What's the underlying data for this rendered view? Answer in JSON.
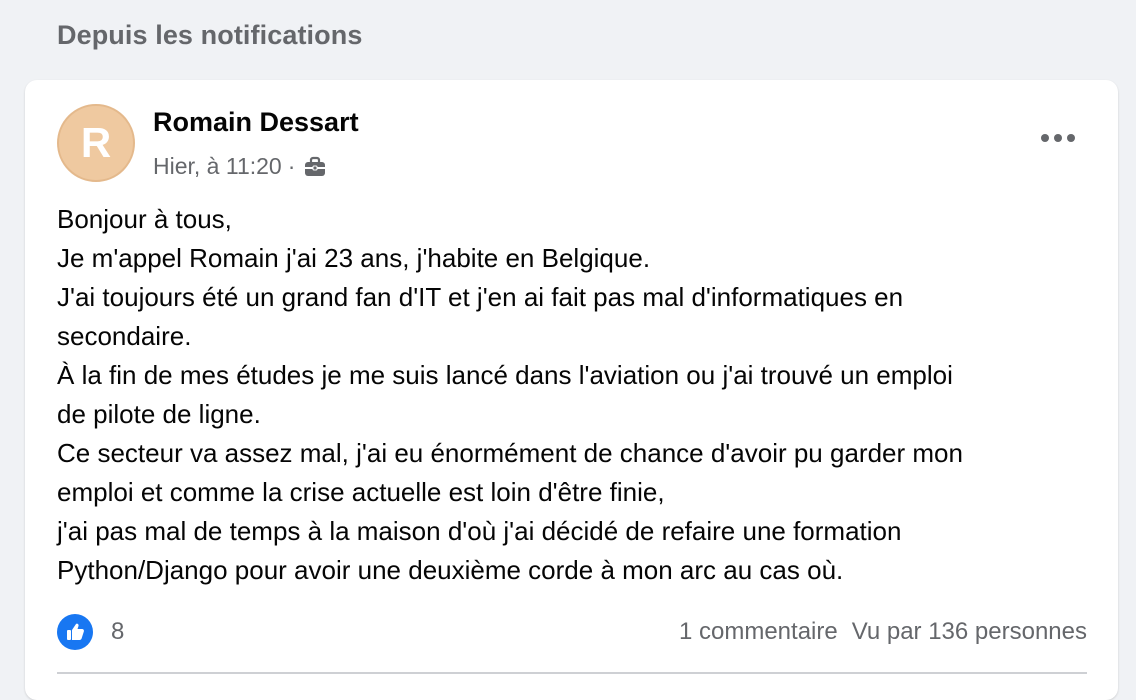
{
  "section": {
    "title": "Depuis les notifications"
  },
  "post": {
    "author": {
      "initial": "R",
      "name": "Romain Dessart",
      "avatar_color": "#efc9a0"
    },
    "timestamp": "Hier, à 11:20",
    "separator": "·",
    "audience_icon": "briefcase-icon",
    "more_icon": "more-options-icon",
    "lines": [
      "Bonjour à tous,",
      "Je m'appel Romain j'ai 23 ans, j'habite en Belgique.",
      "J'ai toujours été un grand fan d'IT et j'en ai fait pas mal d'informatiques en",
      "secondaire.",
      "À la fin de mes études je me suis lancé dans l'aviation ou j'ai trouvé un emploi",
      "de pilote de ligne.",
      "Ce secteur va assez mal, j'ai eu énormément de chance d'avoir pu garder mon",
      "emploi et comme la crise actuelle est loin d'être finie,",
      "j'ai pas mal de temps à la maison d'où j'ai décidé de refaire une formation",
      "Python/Django pour avoir une deuxième corde à mon arc au cas où."
    ],
    "reactions": {
      "icon": "like-icon",
      "count": "8",
      "color": "#1877f2"
    },
    "comments_text": "1 commentaire",
    "views_text": "Vu par 136 personnes"
  }
}
